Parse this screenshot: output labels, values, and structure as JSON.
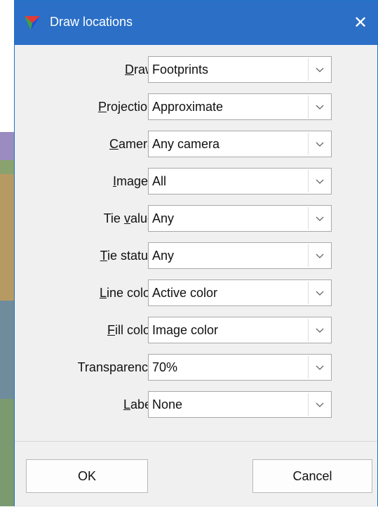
{
  "window": {
    "title": "Draw locations",
    "close_symbol": "✕",
    "app_icon": "colored-triangle-icon"
  },
  "fields": [
    {
      "label_key": "D",
      "label_rest": "raw:",
      "value": "Footprints"
    },
    {
      "label_key": "P",
      "label_rest": "rojection:",
      "value": "Approximate"
    },
    {
      "label_key": "C",
      "label_rest": "amera:",
      "value": "Any camera"
    },
    {
      "label_key": "I",
      "label_rest": "mages:",
      "value": "All"
    },
    {
      "label_pre": "Tie ",
      "label_key": "v",
      "label_rest": "alue:",
      "value": "Any"
    },
    {
      "label_key": "T",
      "label_rest": "ie status:",
      "value": "Any"
    },
    {
      "label_key": "L",
      "label_rest": "ine color:",
      "value": "Active color"
    },
    {
      "label_key": "F",
      "label_rest": "ill color:",
      "value": "Image color"
    },
    {
      "label_rest": "Transparency:",
      "value": "70%"
    },
    {
      "label_key": "L",
      "label_rest": "abel:",
      "value": "None"
    }
  ],
  "buttons": {
    "ok": "OK",
    "cancel": "Cancel"
  },
  "colors": {
    "titlebar": "#2b6fc7",
    "dialog_bg": "#f0f0f0"
  }
}
